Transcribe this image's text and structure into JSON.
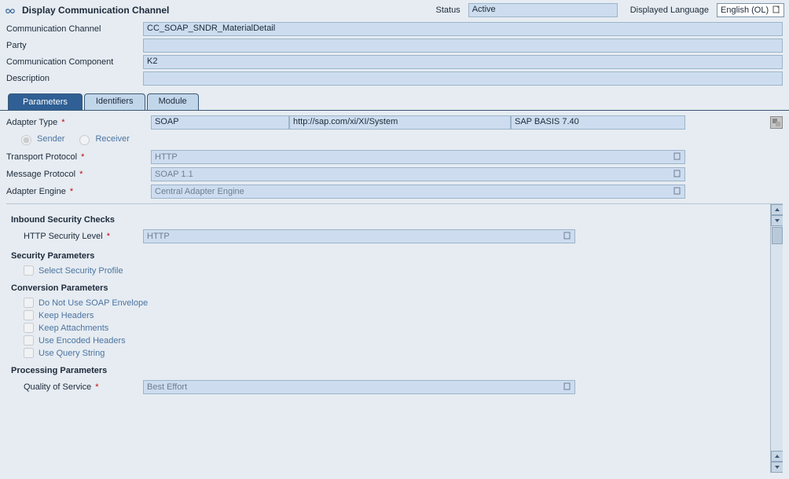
{
  "title": "Display Communication Channel",
  "status_label": "Status",
  "status_value": "Active",
  "language_label": "Displayed Language",
  "language_value": "English (OL)",
  "header": {
    "channel_label": "Communication Channel",
    "channel_value": "CC_SOAP_SNDR_MaterialDetail",
    "party_label": "Party",
    "party_value": "",
    "component_label": "Communication Component",
    "component_value": "K2",
    "description_label": "Description",
    "description_value": ""
  },
  "tabs": {
    "parameters": "Parameters",
    "identifiers": "Identifiers",
    "module": "Module"
  },
  "adapter": {
    "type_label": "Adapter Type",
    "type_value": "SOAP",
    "namespace": "http://sap.com/xi/XI/System",
    "swcv": "SAP BASIS 7.40",
    "sender_label": "Sender",
    "receiver_label": "Receiver",
    "transport_label": "Transport Protocol",
    "transport_value": "HTTP",
    "message_label": "Message Protocol",
    "message_value": "SOAP 1.1",
    "engine_label": "Adapter Engine",
    "engine_value": "Central Adapter Engine"
  },
  "sections": {
    "inbound": "Inbound Security Checks",
    "http_level_label": "HTTP Security Level",
    "http_level_value": "HTTP",
    "security_params": "Security Parameters",
    "select_profile": "Select Security Profile",
    "conversion_params": "Conversion Parameters",
    "no_soap_env": "Do Not Use SOAP Envelope",
    "keep_headers": "Keep Headers",
    "keep_attachments": "Keep Attachments",
    "use_encoded_headers": "Use Encoded Headers",
    "use_query_string": "Use Query String",
    "processing_params": "Processing Parameters",
    "qos_label": "Quality of Service",
    "qos_value": "Best Effort"
  }
}
